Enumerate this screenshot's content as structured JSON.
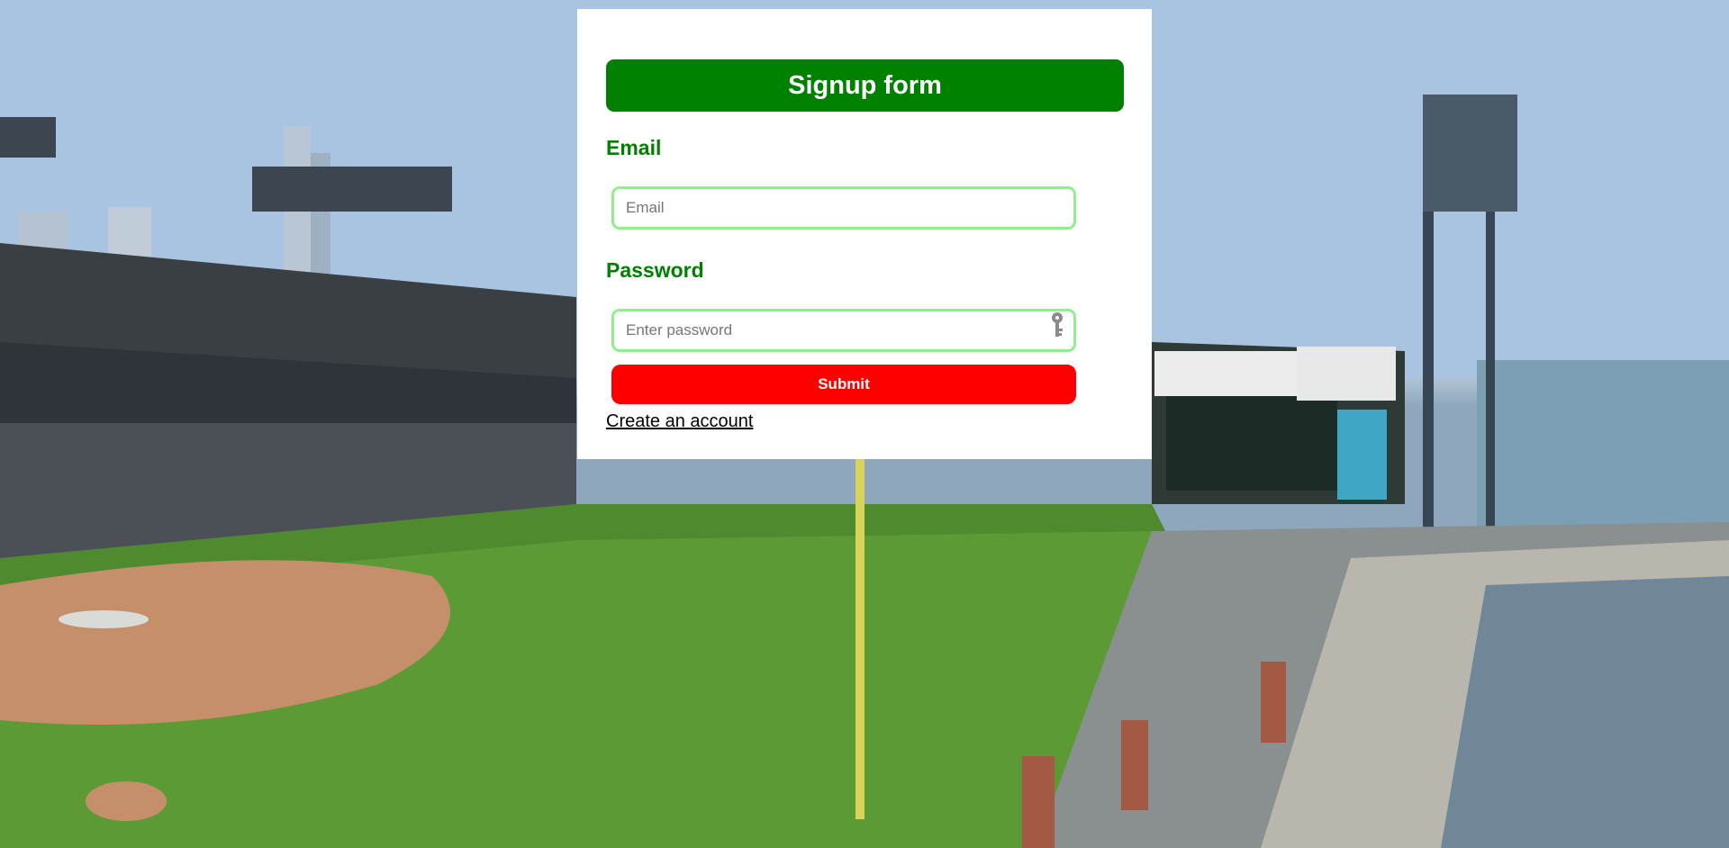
{
  "form": {
    "title": "Signup form",
    "email_label": "Email",
    "email_placeholder": "Email",
    "password_label": "Password",
    "password_placeholder": "Enter password",
    "submit_label": "Submit",
    "create_account_label": "Create an account"
  },
  "icons": {
    "password_icon": "key-icon"
  },
  "colors": {
    "header_bg": "#008000",
    "label_text": "#008000",
    "input_border": "#90ee90",
    "submit_bg": "#ff0000",
    "card_bg": "#ffffff"
  }
}
